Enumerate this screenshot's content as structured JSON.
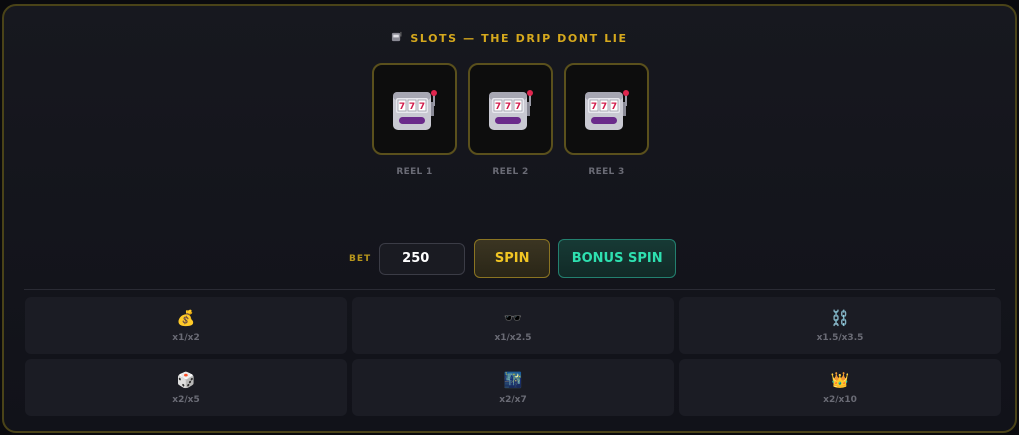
{
  "header": {
    "icon": "slot-machine-icon",
    "title": "SLOTS — THE DRIP DONT LIE"
  },
  "reels": [
    {
      "symbol": "slot-machine-icon",
      "label": "REEL 1"
    },
    {
      "symbol": "slot-machine-icon",
      "label": "REEL 2"
    },
    {
      "symbol": "slot-machine-icon",
      "label": "REEL 3"
    }
  ],
  "controls": {
    "bet_label": "BET",
    "bet_value": "250",
    "spin_label": "SPIN",
    "bonus_spin_label": "BONUS SPIN"
  },
  "paytable": [
    {
      "emoji": "💰",
      "icon": "money-bag-icon",
      "multiplier": "x1/x2"
    },
    {
      "emoji": "🕶️",
      "icon": "sunglasses-icon",
      "multiplier": "x1/x2.5"
    },
    {
      "emoji": "⛓️",
      "icon": "chain-icon",
      "multiplier": "x1.5/x3.5"
    },
    {
      "emoji": "🎲",
      "icon": "dice-icon",
      "multiplier": "x2/x5"
    },
    {
      "emoji": "🌃",
      "icon": "night-city-icon",
      "multiplier": "x2/x7"
    },
    {
      "emoji": "👑",
      "icon": "crown-icon",
      "multiplier": "x2/x10"
    }
  ],
  "colors": {
    "gold_accent": "#d6a91d",
    "teal_accent": "#2ee0b0",
    "panel_border": "#4a4318"
  }
}
